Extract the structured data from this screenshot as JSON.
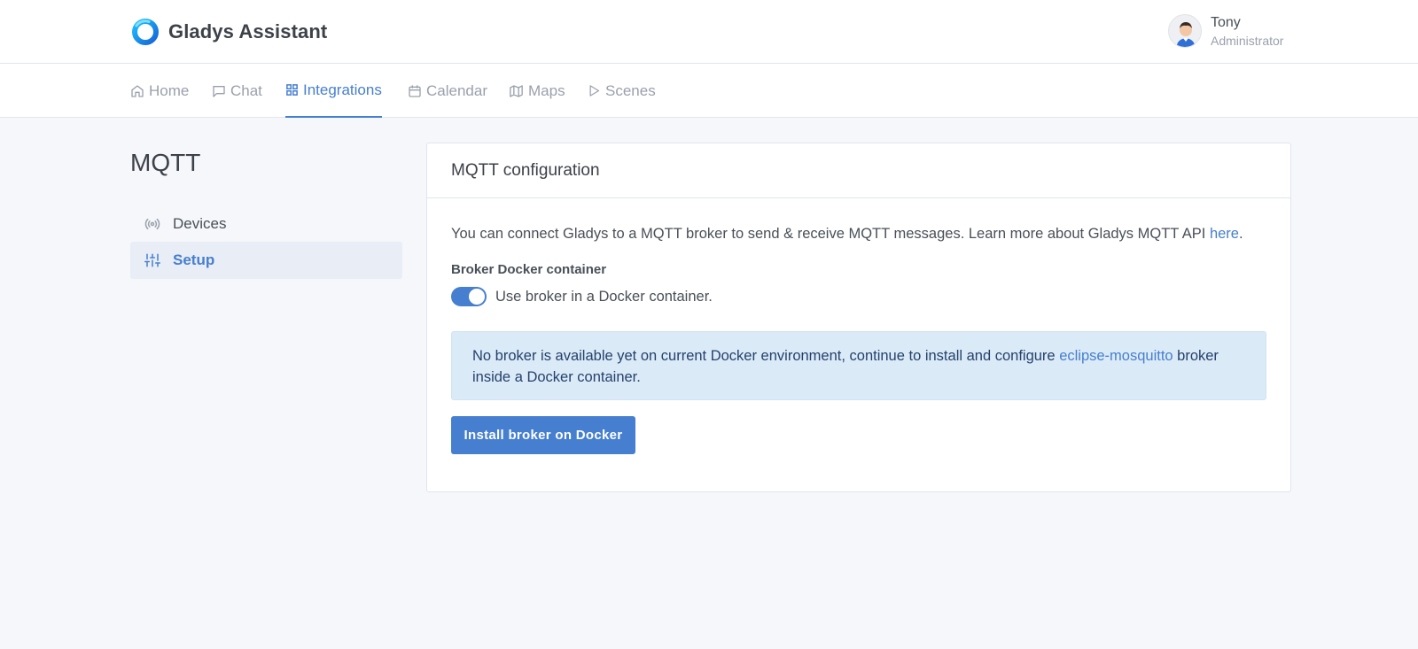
{
  "brand": {
    "name": "Gladys Assistant",
    "logo_icon": "gladys-logo-icon",
    "accent": "#467fcf"
  },
  "user": {
    "name": "Tony",
    "role": "Administrator"
  },
  "nav": [
    {
      "label": "Home",
      "icon": "home-icon"
    },
    {
      "label": "Chat",
      "icon": "chat-icon"
    },
    {
      "label": "Integrations",
      "icon": "grid-icon",
      "active": true
    },
    {
      "label": "Calendar",
      "icon": "calendar-icon"
    },
    {
      "label": "Maps",
      "icon": "map-icon"
    },
    {
      "label": "Scenes",
      "icon": "play-icon"
    }
  ],
  "sidebar": {
    "title": "MQTT",
    "items": [
      {
        "label": "Devices",
        "icon": "radio-icon"
      },
      {
        "label": "Setup",
        "icon": "sliders-icon",
        "active": true
      }
    ]
  },
  "card": {
    "title": "MQTT configuration",
    "intro_text": "You can connect Gladys to a MQTT broker to send & receive MQTT messages. Learn more about Gladys MQTT API ",
    "intro_link": "here",
    "intro_end": ".",
    "docker_label": "Broker Docker container",
    "toggle_text": "Use broker in a Docker container.",
    "toggle_on": true,
    "alert_text": "No broker is available yet on current Docker environment, continue to install and configure ",
    "alert_link": "eclipse-mosquitto",
    "alert_text_end": " broker inside a Docker container.",
    "install_button": "Install broker on Docker"
  }
}
